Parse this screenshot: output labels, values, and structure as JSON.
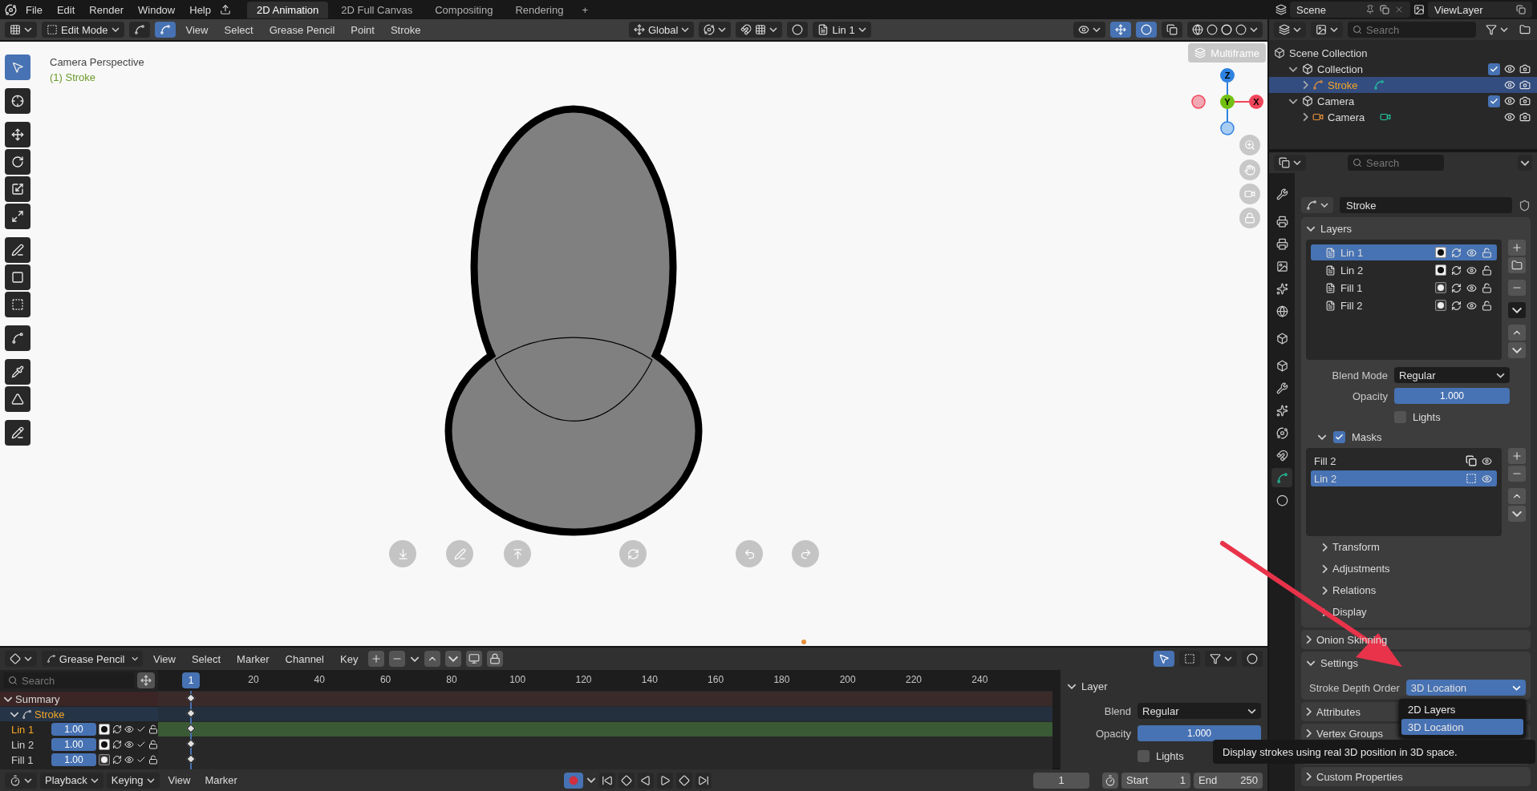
{
  "topbar": {
    "menus": [
      "File",
      "Edit",
      "Render",
      "Window",
      "Help"
    ],
    "workspaces": [
      {
        "label": "2D Animation",
        "selected": true
      },
      {
        "label": "2D Full Canvas",
        "selected": false
      },
      {
        "label": "Compositing",
        "selected": false
      },
      {
        "label": "Rendering",
        "selected": false
      }
    ],
    "add_label": "+",
    "scene": "Scene",
    "view_layer": "ViewLayer"
  },
  "viewport_header": {
    "mode": "Edit Mode",
    "menus": [
      "View",
      "Select",
      "Grease Pencil",
      "Point",
      "Stroke"
    ],
    "orientation": "Global",
    "active_layer": "Lin 1",
    "multiframe": "Multiframe"
  },
  "viewport": {
    "view_name": "Camera Perspective",
    "object_name": "(1) Stroke",
    "gizmo": [
      {
        "label": "Z",
        "color": "#2f83e0"
      },
      {
        "label": "Y",
        "color": "#72c013"
      },
      {
        "label": "X",
        "color": "#f1455a"
      }
    ]
  },
  "outliner": {
    "search_placeholder": "Search",
    "items": [
      {
        "label": "Scene Collection",
        "kind": "root",
        "children": [
          {
            "label": "Collection",
            "kind": "collection",
            "expanded": true,
            "checked": true,
            "selected": false,
            "children": [
              {
                "label": "Stroke",
                "kind": "grease_pencil",
                "expanded": false,
                "selected": true
              }
            ]
          },
          {
            "label": "Camera",
            "kind": "collection",
            "expanded": true,
            "checked": true,
            "selected": false,
            "children": [
              {
                "label": "Camera",
                "kind": "camera",
                "expanded": false,
                "selected": false
              }
            ]
          }
        ]
      }
    ]
  },
  "properties": {
    "search_placeholder": "Search",
    "tabs": [
      {
        "selected": false
      },
      {
        "selected": false
      },
      {
        "selected": false
      },
      {
        "selected": false
      },
      {
        "selected": false
      },
      {
        "selected": false
      },
      {
        "selected": false
      },
      {
        "selected": false
      },
      {
        "selected": false
      },
      {
        "selected": false
      },
      {
        "selected": false
      },
      {
        "selected": false
      },
      {
        "selected": true
      },
      {
        "selected": false
      }
    ],
    "data_name": "Stroke",
    "layers_title": "Layers",
    "layers": [
      {
        "name": "Lin 1",
        "selected": true,
        "mask_on": true
      },
      {
        "name": "Lin 2",
        "selected": false,
        "mask_on": true
      },
      {
        "name": "Fill 1",
        "selected": false,
        "mask_on": false
      },
      {
        "name": "Fill 2",
        "selected": false,
        "mask_on": false
      }
    ],
    "blend_label": "Blend Mode",
    "blend": "Regular",
    "opacity_label": "Opacity",
    "opacity": {
      "value": "1.000",
      "level": 1
    },
    "lights": {
      "label": "Lights",
      "checked": false
    },
    "masks": {
      "label": "Masks",
      "checked": true,
      "expanded": true,
      "items": [
        {
          "name": "Fill 2",
          "inverted": false,
          "selected": false
        },
        {
          "name": "Lin 2",
          "inverted": true,
          "selected": true
        }
      ]
    },
    "subpanels": [
      {
        "label": "Transform",
        "expanded": false
      },
      {
        "label": "Adjustments",
        "expanded": false
      },
      {
        "label": "Relations",
        "expanded": false
      },
      {
        "label": "Display",
        "expanded": false
      }
    ],
    "panels": [
      {
        "label": "Onion Skinning",
        "kind": "plain",
        "expanded": false
      },
      {
        "label": "Settings",
        "kind": "settings",
        "expanded": true
      },
      {
        "label": "Attributes",
        "kind": "plain",
        "expanded": false
      },
      {
        "label": "Vertex Groups",
        "kind": "plain",
        "expanded": false
      },
      {
        "label": "Custom Properties",
        "kind": "plain",
        "expanded": false
      }
    ],
    "depth_order": {
      "label": "Stroke Depth Order",
      "value": "3D Location",
      "options": [
        {
          "label": "2D Layers",
          "selected": false
        },
        {
          "label": "3D Location",
          "selected": true
        }
      ]
    },
    "tooltip": "Display strokes using real 3D position in 3D space."
  },
  "timeline": {
    "mode": "Grease Pencil",
    "menus": [
      "View",
      "Select",
      "Marker",
      "Channel",
      "Key"
    ],
    "search_placeholder": "Search",
    "current_frame": "1",
    "ticks": [
      "20",
      "40",
      "60",
      "80",
      "100",
      "120",
      "140",
      "160",
      "180",
      "200",
      "220",
      "240"
    ],
    "channels": [
      {
        "name": "Summary",
        "kind": "summary"
      },
      {
        "name": "Stroke",
        "kind": "object"
      },
      {
        "name": "Lin 1",
        "kind": "layer",
        "opacity": {
          "value": "1.00",
          "level": 1
        },
        "active": true,
        "mask_on": true
      },
      {
        "name": "Lin 2",
        "kind": "layer",
        "opacity": {
          "value": "1.00",
          "level": 1
        },
        "active": false,
        "mask_on": true
      },
      {
        "name": "Fill 1",
        "kind": "layer",
        "opacity": {
          "value": "1.00",
          "level": 1
        },
        "active": false,
        "mask_on": false
      }
    ],
    "sidebar": {
      "title": "Layer",
      "blend_label": "Blend",
      "blend": "Regular",
      "opacity_label": "Opacity",
      "opacity": {
        "value": "1.000",
        "level": 1
      },
      "lights": {
        "label": "Lights",
        "checked": false
      }
    }
  },
  "playback": {
    "menus": [
      "Playback",
      "Keying"
    ],
    "links": [
      "View",
      "Marker"
    ],
    "auto_key": true,
    "frame": "1",
    "start_label": "Start",
    "start": "1",
    "end_label": "End",
    "end": "250"
  }
}
